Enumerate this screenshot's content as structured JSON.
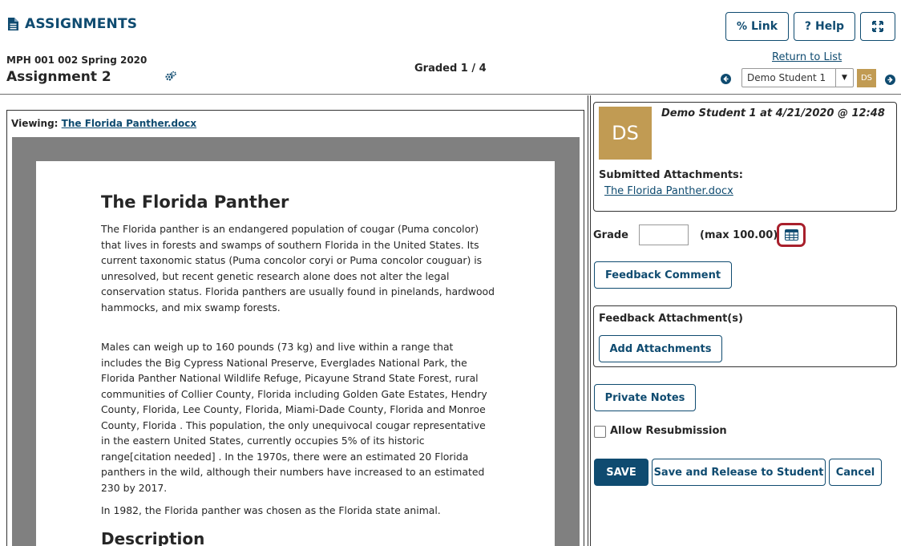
{
  "header": {
    "tool_title": "ASSIGNMENTS",
    "link_label": "Link",
    "help_label": "Help",
    "site_title": "MPH 001 002 Spring 2020",
    "assignment_title": "Assignment 2",
    "graded_status": "Graded 1 / 4",
    "return_link": "Return to List",
    "student_select": "Demo Student 1",
    "student_initials": "DS"
  },
  "viewer": {
    "viewing_label": "Viewing:",
    "file_name": "The Florida Panther.docx",
    "doc_title": "The Florida Panther",
    "paragraphs": [
      "The Florida panther is an endangered population of cougar (Puma concolor) that lives in forests and swamps of southern Florida in the United States. Its current taxonomic status (Puma concolor coryi or Puma concolor couguar) is unresolved, but recent genetic research alone does not alter the legal conservation status. Florida panthers are usually found in pinelands, hardwood hammocks, and mix swamp forests.",
      "Males can weigh up to 160 pounds (73 kg) and live within a range that includes the Big Cypress National Preserve, Everglades National Park, the Florida Panther National Wildlife Refuge, Picayune Strand State Forest, rural communities of Collier County, Florida including Golden Gate Estates, Hendry County, Florida, Lee County, Florida, Miami-Dade County, Florida and Monroe County, Florida . This population, the only unequivocal cougar representative in the eastern United States, currently occupies 5% of its historic range[citation needed] . In the 1970s, there were an estimated 20 Florida panthers in the wild, although their numbers have increased to an estimated 230 by 2017.",
      "In 1982, the Florida panther was chosen as the Florida state animal."
    ],
    "doc_subheading": "Description"
  },
  "grading": {
    "avatar_initials": "DS",
    "submission_info": "Demo Student 1 at 4/21/2020 @ 12:48",
    "submitted_attachments_label": "Submitted Attachments:",
    "attachment_link": "The Florida Panther.docx",
    "grade_label": "Grade",
    "grade_value": "",
    "grade_max": "(max 100.00)",
    "feedback_comment_button": "Feedback Comment",
    "feedback_attachments_label": "Feedback Attachment(s)",
    "add_attachments_button": "Add Attachments",
    "private_notes_button": "Private Notes",
    "allow_resubmission_label": "Allow Resubmission",
    "save_button": "SAVE",
    "save_release_button": "Save and Release to Student",
    "cancel_button": "Cancel"
  },
  "colors": {
    "primary": "#0f4b70",
    "avatar": "#c19b53",
    "highlight": "#a8202c",
    "viewer_bg": "#808080"
  }
}
